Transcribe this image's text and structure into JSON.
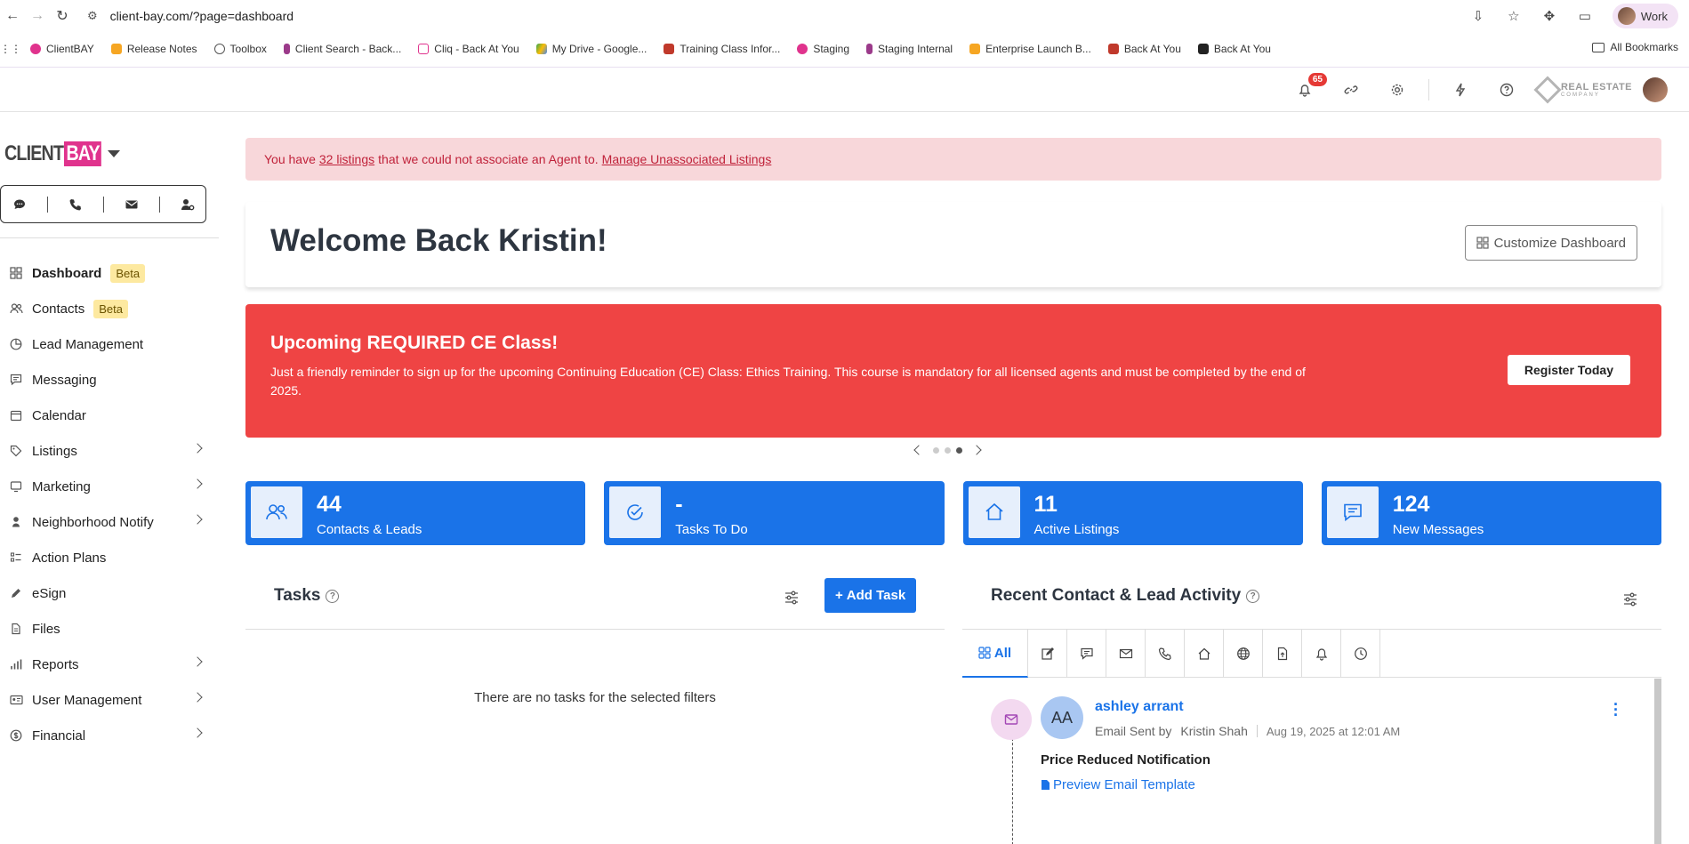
{
  "browser": {
    "url": "client-bay.com/?page=dashboard",
    "profile_label": "Work",
    "bookmarks": [
      "ClientBAY",
      "Release Notes",
      "Toolbox",
      "Client Search - Back...",
      "Cliq - Back At You",
      "My Drive - Google...",
      "Training Class Infor...",
      "Staging",
      "Staging Internal",
      "Enterprise Launch B...",
      "Back At You",
      "Back At You"
    ],
    "all_bookmarks": "All Bookmarks"
  },
  "header": {
    "notification_count": "65",
    "brand_line1": "REAL ESTATE",
    "brand_line2": "COMPANY"
  },
  "sidebar": {
    "logo_client": "CLIENT",
    "logo_bay": "BAY",
    "items": [
      {
        "label": "Dashboard",
        "badge": "Beta"
      },
      {
        "label": "Contacts",
        "badge": "Beta"
      },
      {
        "label": "Lead Management"
      },
      {
        "label": "Messaging"
      },
      {
        "label": "Calendar"
      },
      {
        "label": "Listings"
      },
      {
        "label": "Marketing"
      },
      {
        "label": "Neighborhood Notify"
      },
      {
        "label": "Action Plans"
      },
      {
        "label": "eSign"
      },
      {
        "label": "Files"
      },
      {
        "label": "Reports"
      },
      {
        "label": "User Management"
      },
      {
        "label": "Financial"
      }
    ]
  },
  "alert": {
    "prefix": "You have",
    "link_count": "32 listings",
    "middle": "that we could not associate an Agent to.",
    "manage_link": "Manage Unassociated Listings"
  },
  "welcome": {
    "title": "Welcome Back Kristin!",
    "customize_label": "Customize Dashboard"
  },
  "banner": {
    "title": "Upcoming REQUIRED CE Class!",
    "body": "Just a friendly reminder to sign up for the upcoming Continuing Education (CE) Class: Ethics Training. This course is mandatory for all licensed agents and must be completed by the end of 2025.",
    "button": "Register Today"
  },
  "stats": [
    {
      "value": "44",
      "label": "Contacts & Leads"
    },
    {
      "value": "-",
      "label": "Tasks To Do"
    },
    {
      "value": "11",
      "label": "Active Listings"
    },
    {
      "value": "124",
      "label": "New Messages"
    }
  ],
  "tasks": {
    "title": "Tasks",
    "add_label": "Add Task",
    "empty": "There are no tasks for the selected filters"
  },
  "activity": {
    "title": "Recent Contact & Lead Activity",
    "all_tab": "All",
    "entry": {
      "initials": "AA",
      "name": "ashley arrant",
      "action": "Email Sent by",
      "agent": "Kristin Shah",
      "date": "Aug 19, 2025 at 12:01 AM",
      "subject": "Price Reduced Notification",
      "preview": "Preview Email Template"
    }
  },
  "colors": {
    "primary": "#1a73e8",
    "banner": "#ef4444",
    "alert_bg": "#f8d7da",
    "alert_text": "#c0223a",
    "brand_pink": "#e0338d",
    "beta_bg": "#fde9a0"
  }
}
